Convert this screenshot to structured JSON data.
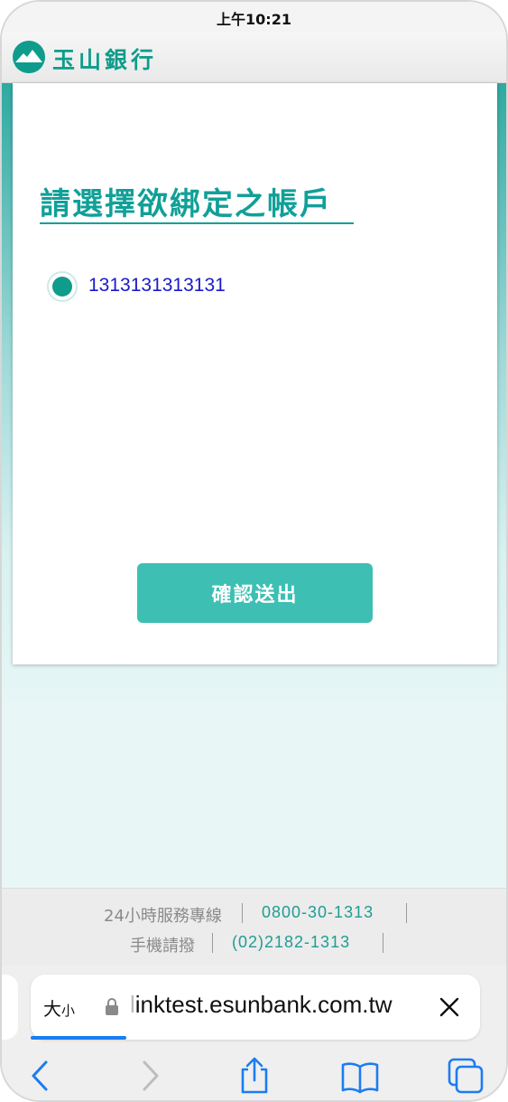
{
  "status_bar": {
    "time": "上午10:21"
  },
  "header": {
    "logo_text": "玉山銀行"
  },
  "main": {
    "title": "請選擇欲綁定之帳戶",
    "accounts": [
      {
        "number": "1313131313131",
        "selected": true
      }
    ],
    "confirm_label": "確認送出"
  },
  "footer": {
    "hotline_label": "24小時服務專線",
    "hotline_number": "0800-30-1313",
    "mobile_label": "手機請撥",
    "mobile_number": "(02)2182-1313"
  },
  "browser": {
    "text_size_label_big": "大",
    "text_size_label_small": "小",
    "url_first_char": "l",
    "url_rest": "inktest.esunbank.com.tw",
    "icons": [
      "lock-icon",
      "close-icon",
      "back-icon",
      "forward-icon",
      "share-icon",
      "bookmarks-icon",
      "tabs-icon"
    ]
  },
  "colors": {
    "brand": "#0f9c8c",
    "button": "#3dbfb3",
    "link": "#1a1acb",
    "safari_blue": "#1c7cf0"
  }
}
